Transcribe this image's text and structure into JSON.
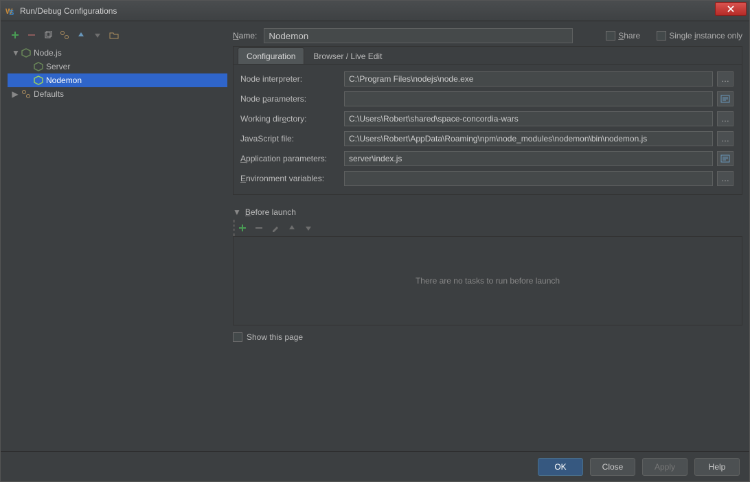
{
  "window": {
    "title": "Run/Debug Configurations"
  },
  "tree": {
    "root1": {
      "label": "Node.js",
      "expanded": true
    },
    "server": {
      "label": "Server"
    },
    "nodemon": {
      "label": "Nodemon"
    },
    "defaults": {
      "label": "Defaults",
      "expanded": false
    }
  },
  "top": {
    "name_label": "Name:",
    "name_value": "Nodemon",
    "share_label": "Share",
    "single_label": "Single instance only"
  },
  "tabs": {
    "config": "Configuration",
    "browser": "Browser / Live Edit"
  },
  "fields": {
    "node_interpreter": {
      "label": "Node interpreter:",
      "value": "C:\\Program Files\\nodejs\\node.exe"
    },
    "node_parameters": {
      "label": "Node parameters:",
      "value": ""
    },
    "working_directory": {
      "label": "Working directory:",
      "value": "C:\\Users\\Robert\\shared\\space-concordia-wars"
    },
    "javascript_file": {
      "label": "JavaScript file:",
      "value": "C:\\Users\\Robert\\AppData\\Roaming\\npm\\node_modules\\nodemon\\bin\\nodemon.js"
    },
    "app_parameters": {
      "label": "Application parameters:",
      "value": "server\\index.js"
    },
    "env_vars": {
      "label": "Environment variables:",
      "value": ""
    }
  },
  "before": {
    "header": "Before launch",
    "empty": "There are no tasks to run before launch",
    "show_this": "Show this page"
  },
  "footer": {
    "ok": "OK",
    "close": "Close",
    "apply": "Apply",
    "help": "Help"
  }
}
